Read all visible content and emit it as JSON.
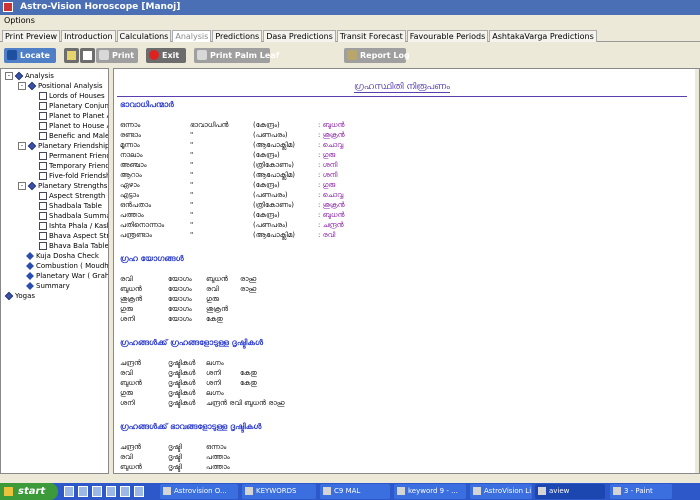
{
  "window": {
    "title": "Astro-Vision Horoscope [Manoj]"
  },
  "menu": {
    "options": "Options"
  },
  "tabs": [
    "Print Preview",
    "Introduction",
    "Calculations",
    "Analysis",
    "Predictions",
    "Dasa Predictions",
    "Transit Forecast",
    "Favourable Periods",
    "AshtakaVarga Predictions"
  ],
  "active_tab": "Analysis",
  "toolbar": {
    "locate": "Locate",
    "print": "Print",
    "exit": "Exit",
    "print_palm_leaf": "Print Palm Leaf",
    "report_log": "Report Log"
  },
  "tree": [
    {
      "label": "Analysis",
      "level": 0,
      "toggle": "-",
      "icon": "book"
    },
    {
      "label": "Positional Analysis",
      "level": 1,
      "toggle": "-",
      "icon": "book"
    },
    {
      "label": "Lords of Houses",
      "level": 2,
      "icon": "doc"
    },
    {
      "label": "Planetary Conjunc",
      "level": 2,
      "icon": "doc"
    },
    {
      "label": "Planet to Planet A:",
      "level": 2,
      "icon": "doc"
    },
    {
      "label": "Planet to House A",
      "level": 2,
      "icon": "doc"
    },
    {
      "label": "Benefic and Malef",
      "level": 2,
      "icon": "doc"
    },
    {
      "label": "Planetary Friendship C",
      "level": 1,
      "toggle": "-",
      "icon": "book"
    },
    {
      "label": "Permanent Friends",
      "level": 2,
      "icon": "doc"
    },
    {
      "label": "Temporary Friends",
      "level": 2,
      "icon": "doc"
    },
    {
      "label": "Five-fold Friendshi",
      "level": 2,
      "icon": "doc"
    },
    {
      "label": "Planetary Strengths",
      "level": 1,
      "toggle": "-",
      "icon": "book"
    },
    {
      "label": "Aspect Strength C",
      "level": 2,
      "icon": "doc"
    },
    {
      "label": "Shadbala Table",
      "level": 2,
      "icon": "doc"
    },
    {
      "label": "Shadbala Summar",
      "level": 2,
      "icon": "doc"
    },
    {
      "label": "Ishta Phala / Kash",
      "level": 2,
      "icon": "doc"
    },
    {
      "label": "Bhava Aspect Stre",
      "level": 2,
      "icon": "doc"
    },
    {
      "label": "Bhava Bala Table",
      "level": 2,
      "icon": "doc"
    },
    {
      "label": "Kuja Dosha Check",
      "level": 1,
      "icon": "diamond"
    },
    {
      "label": "Combustion ( Moudhya",
      "level": 1,
      "icon": "diamond"
    },
    {
      "label": "Planetary War ( Graha",
      "level": 1,
      "icon": "diamond"
    },
    {
      "label": "Summary",
      "level": 1,
      "icon": "diamond"
    },
    {
      "label": "Yogas",
      "level": 0,
      "icon": "book"
    }
  ],
  "report": {
    "title": "ഗ്രഹസ്ഥിതി നിരൂപണം",
    "sections": [
      {
        "heading": "ഭാവാധിപന്മാർ",
        "rows": [
          [
            "ഒന്നാം",
            "ഭാവാധിപൻ",
            "(കേന്ദ്രം)",
            ": ബുധൻ"
          ],
          [
            "രണ്ടാം",
            "\"",
            "(പണപരം)",
            ": ശുക്രൻ"
          ],
          [
            "മൂന്നാം",
            "\"",
            "(ആപോക്ലിമ)",
            ": ചൊവ്വ"
          ],
          [
            "നാലാം",
            "\"",
            "(കേന്ദ്രം)",
            ": ഗുരു"
          ],
          [
            "അഞ്ചാം",
            "\"",
            "(ത്രികോണം)",
            ": ശനി"
          ],
          [
            "ആറാം",
            "\"",
            "(ആപോക്ലിമ)",
            ": ശനി"
          ],
          [
            "ഏഴാം",
            "\"",
            "(കേന്ദ്രം)",
            ": ഗുരു"
          ],
          [
            "എട്ടാം",
            "\"",
            "(പണപരം)",
            ": ചൊവ്വ"
          ],
          [
            "ഒൻപതാം",
            "\"",
            "(ത്രികോണം)",
            ": ശുക്രൻ"
          ],
          [
            "പത്താം",
            "\"",
            "(കേന്ദ്രം)",
            ": ബുധൻ"
          ],
          [
            "പതിനൊന്നാം",
            "\"",
            "(പണപരം)",
            ": ചന്ദ്രൻ"
          ],
          [
            "പന്ത്രണ്ടാം",
            "\"",
            "(ആപോക്ലിമ)",
            ": രവി"
          ]
        ]
      },
      {
        "heading": "ഗ്രഹ യോഗങ്ങൾ",
        "rows": [
          [
            "രവി",
            "യോഗം",
            "ബുധൻ",
            "രാഹു"
          ],
          [
            "ബുധൻ",
            "യോഗം",
            "രവി",
            "രാഹു"
          ],
          [
            "ശുക്രൻ",
            "യോഗം",
            "ഗുരു",
            ""
          ],
          [
            "ഗുരു",
            "യോഗം",
            "ശുക്രൻ",
            ""
          ],
          [
            "ശനി",
            "യോഗം",
            "കേതു",
            ""
          ]
        ]
      },
      {
        "heading": "ഗ്രഹങ്ങൾക്ക് ഗ്രഹങ്ങളോടുള്ള ദൃഷ്ടികൾ",
        "rows": [
          [
            "ചന്ദ്രൻ",
            "ദൃഷ്ടികൾ",
            "ലഗ്നം",
            ""
          ],
          [
            "രവി",
            "ദൃഷ്ടികൾ",
            "ശനി",
            "കേതു"
          ],
          [
            "ബുധൻ",
            "ദൃഷ്ടികൾ",
            "ശനി",
            "കേതു"
          ],
          [
            "ഗുരു",
            "ദൃഷ്ടികൾ",
            "ലഗ്നം",
            ""
          ],
          [
            "ശനി",
            "ദൃഷ്ടികൾ",
            "ചന്ദ്രൻ  രവി  ബുധൻ  രാഹു",
            ""
          ]
        ]
      },
      {
        "heading": "ഗ്രഹങ്ങൾക്ക് ഭാവങ്ങളോടുള്ള ദൃഷ്ടികൾ",
        "rows": [
          [
            "ചന്ദ്രൻ",
            "ദൃഷ്ടി",
            "ഒന്നാം",
            ""
          ],
          [
            "രവി",
            "ദൃഷ്ടി",
            "പത്താം",
            ""
          ],
          [
            "ബുധൻ",
            "ദൃഷ്ടി",
            "പത്താം",
            ""
          ]
        ]
      }
    ]
  },
  "taskbar": {
    "start": "start",
    "tasks": [
      "Astrovision O...",
      "KEYWORDS",
      "C9 MAL",
      "keyword 9 - ...",
      "AstroVision Li...",
      "aview",
      "3 - Paint"
    ],
    "active_task": "aview"
  },
  "colors": {
    "titlebar": "#4a6fb4",
    "heading": "#2a3ad0",
    "report_title": "#5b3fb1",
    "taskbar": "#2c58c9",
    "start": "#3c9a3b"
  }
}
